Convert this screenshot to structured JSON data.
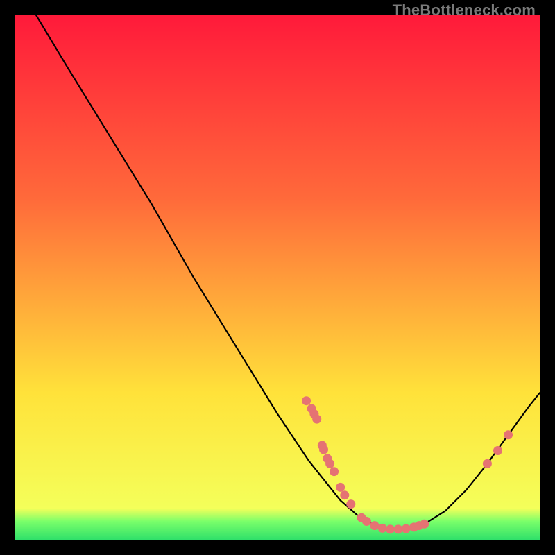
{
  "watermark": "TheBottleneck.com",
  "colors": {
    "gradient_top": "#ff1a3a",
    "gradient_mid1": "#ff6a3a",
    "gradient_mid2": "#ffe23a",
    "gradient_bottom_band": "#2fe06a",
    "curve": "#000000",
    "dot_fill": "#e57373",
    "dot_stroke": "#e57373"
  },
  "chart_data": {
    "type": "line",
    "title": "",
    "xlabel": "",
    "ylabel": "",
    "xlim": [
      0,
      100
    ],
    "ylim": [
      0,
      100
    ],
    "grid": false,
    "legend": false,
    "curve_points": [
      {
        "x": 4.0,
        "y": 100.0
      },
      {
        "x": 10.0,
        "y": 90.0
      },
      {
        "x": 18.0,
        "y": 77.0
      },
      {
        "x": 26.0,
        "y": 64.0
      },
      {
        "x": 34.0,
        "y": 50.0
      },
      {
        "x": 42.0,
        "y": 37.0
      },
      {
        "x": 50.0,
        "y": 24.0
      },
      {
        "x": 56.0,
        "y": 15.0
      },
      {
        "x": 62.0,
        "y": 7.5
      },
      {
        "x": 66.0,
        "y": 4.0
      },
      {
        "x": 70.0,
        "y": 2.3
      },
      {
        "x": 74.0,
        "y": 2.0
      },
      {
        "x": 78.0,
        "y": 3.0
      },
      {
        "x": 82.0,
        "y": 5.5
      },
      {
        "x": 86.0,
        "y": 9.5
      },
      {
        "x": 90.0,
        "y": 14.5
      },
      {
        "x": 94.0,
        "y": 20.0
      },
      {
        "x": 98.0,
        "y": 25.5
      },
      {
        "x": 100.0,
        "y": 28.0
      }
    ],
    "series": [
      {
        "name": "markers",
        "points": [
          {
            "x": 55.5,
            "y": 26.5
          },
          {
            "x": 56.5,
            "y": 25.0
          },
          {
            "x": 57.0,
            "y": 24.0
          },
          {
            "x": 57.5,
            "y": 23.0
          },
          {
            "x": 58.5,
            "y": 18.0
          },
          {
            "x": 58.8,
            "y": 17.2
          },
          {
            "x": 59.5,
            "y": 15.5
          },
          {
            "x": 60.0,
            "y": 14.5
          },
          {
            "x": 60.8,
            "y": 13.0
          },
          {
            "x": 62.0,
            "y": 10.0
          },
          {
            "x": 62.8,
            "y": 8.5
          },
          {
            "x": 64.0,
            "y": 6.8
          },
          {
            "x": 66.0,
            "y": 4.2
          },
          {
            "x": 67.0,
            "y": 3.5
          },
          {
            "x": 68.5,
            "y": 2.7
          },
          {
            "x": 70.0,
            "y": 2.2
          },
          {
            "x": 71.5,
            "y": 2.0
          },
          {
            "x": 73.0,
            "y": 2.0
          },
          {
            "x": 74.5,
            "y": 2.1
          },
          {
            "x": 76.0,
            "y": 2.4
          },
          {
            "x": 77.0,
            "y": 2.7
          },
          {
            "x": 78.0,
            "y": 3.0
          },
          {
            "x": 90.0,
            "y": 14.5
          },
          {
            "x": 92.0,
            "y": 17.0
          },
          {
            "x": 94.0,
            "y": 20.0
          }
        ]
      }
    ],
    "green_band_y": [
      0,
      4
    ]
  }
}
